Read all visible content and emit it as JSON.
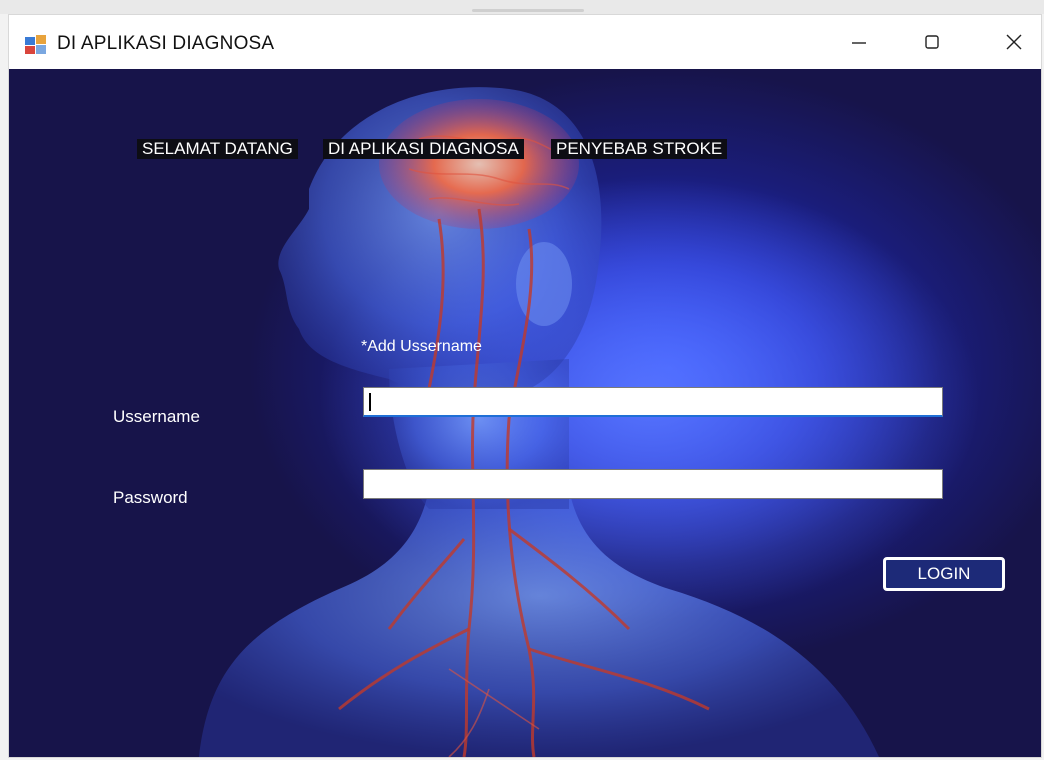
{
  "window": {
    "title": "DI APLIKASI DIAGNOSA",
    "controls": {
      "minimize_icon": "minimize-icon",
      "maximize_icon": "maximize-icon",
      "close_icon": "close-icon"
    }
  },
  "header_labels": {
    "selamat": "SELAMAT DATANG",
    "aplikasi": "DI APLIKASI DIAGNOSA",
    "penyebab": "PENYEBAB STROKE"
  },
  "form": {
    "hint": "*Add Ussername",
    "username_label": "Ussername",
    "username_value": "",
    "password_label": "Password",
    "password_value": "",
    "login_label": "LOGIN"
  },
  "colors": {
    "background_glow": "#2f4cff",
    "background_dark": "#17144a",
    "label_bg": "#0d0d14",
    "vessels": "#c0392b",
    "brain": "#ff6a3a"
  }
}
